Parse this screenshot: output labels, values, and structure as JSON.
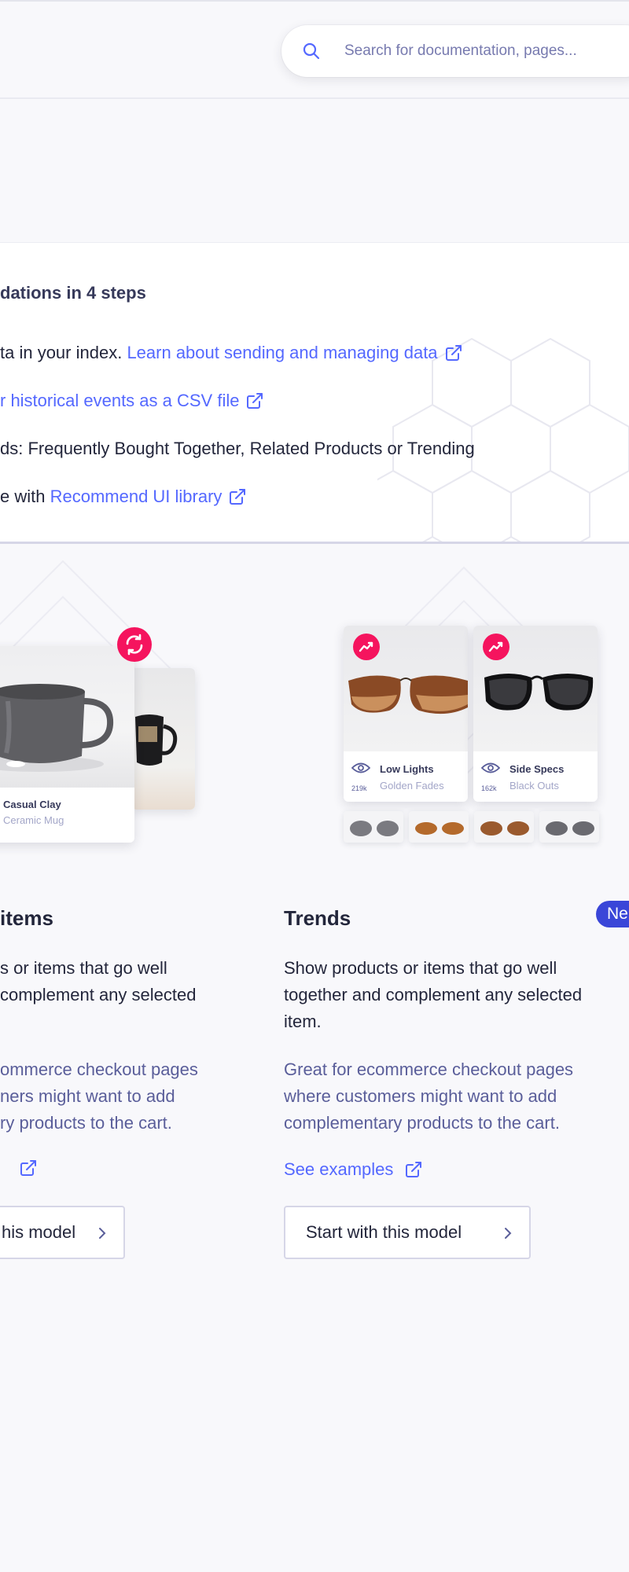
{
  "search": {
    "placeholder": "Search for documentation, pages...",
    "icon": "search-icon"
  },
  "steps": {
    "title": "dations in 4 steps",
    "step1_text": "ta in your index. ",
    "step1_link": "Learn about sending and managing data",
    "step2_link": "r historical events as a CSV file",
    "step3_text": "ds: Frequently Bought Together, Related Products or Trending",
    "step4_text": "e with ",
    "step4_link": "Recommend UI library"
  },
  "card_left": {
    "title": "items",
    "description": "s or items that go well\ncomplement any selected",
    "note": "ommerce checkout pages\nners might want to add\nry products to the cart.",
    "button_label": "his model",
    "product_name": "Casual Clay",
    "product_sub": "Ceramic Mug"
  },
  "card_right": {
    "title": "Trends",
    "badge": "Ne",
    "description": "Show products or items that go well together and complement any selected item.",
    "note": "Great for ecommerce checkout pages where customers might want to add complementary products to the cart.",
    "see_examples": "See examples",
    "button_label": "Start with this model",
    "products": [
      {
        "name": "Low Lights",
        "sub": "Golden Fades",
        "count": "219k"
      },
      {
        "name": "Side Specs",
        "sub": "Black Outs",
        "count": "162k"
      }
    ]
  },
  "colors": {
    "accent": "#5468ff",
    "badge": "#3a46d8",
    "pink": "#f5145e",
    "text": "#23263b",
    "muted": "#5a5e9a"
  }
}
